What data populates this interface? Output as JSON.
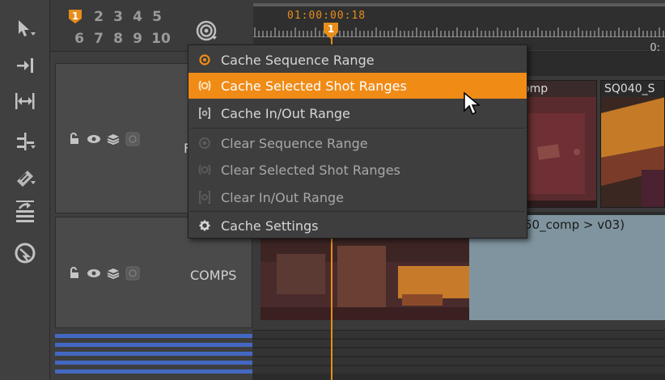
{
  "viewer_numbers": {
    "row1": [
      "1",
      "2",
      "3",
      "4",
      "5"
    ],
    "row2": [
      "6",
      "7",
      "8",
      "9",
      "10"
    ]
  },
  "timeline": {
    "timecode": "01:00:00:18",
    "ruler_right_label": "0:",
    "playhead_badge": "1"
  },
  "tracks": [
    {
      "name": "F"
    },
    {
      "name": "COMPS"
    }
  ],
  "clips": {
    "clip_a_label": "omp",
    "clip_b_label": "SQ040_S",
    "clip_c_label": "50_comp > v03)"
  },
  "cache_menu": {
    "items": [
      {
        "label": "Cache Sequence Range",
        "icon": "cache-sequence-icon"
      },
      {
        "label": "Cache Selected Shot Ranges",
        "icon": "cache-selected-icon"
      },
      {
        "label": "Cache In/Out Range",
        "icon": "cache-inout-icon"
      },
      {
        "label": "Clear Sequence Range",
        "icon": "clear-sequence-icon"
      },
      {
        "label": "Clear Selected Shot Ranges",
        "icon": "clear-selected-icon"
      },
      {
        "label": "Clear In/Out Range",
        "icon": "clear-inout-icon"
      },
      {
        "label": "Cache Settings",
        "icon": "gear-icon"
      }
    ],
    "highlighted_index": 1
  },
  "colors": {
    "accent": "#f08b16",
    "bar_blue": "#4468c2"
  }
}
